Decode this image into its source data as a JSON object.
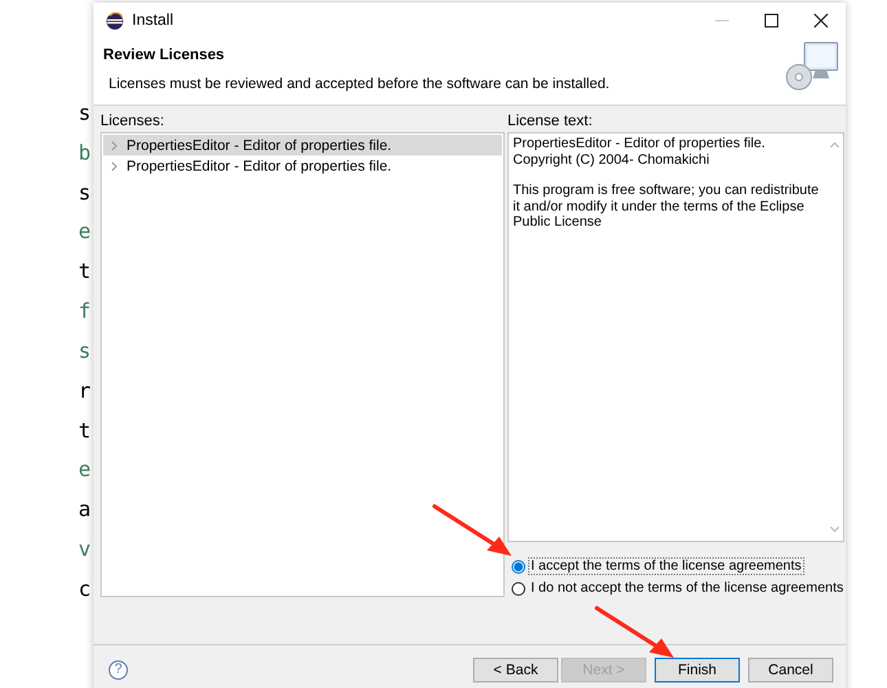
{
  "background_window": {
    "left_letters": [
      {
        "text": "s",
        "color": "#000000"
      },
      {
        "text": "b",
        "color": "#3f7f5f"
      },
      {
        "text": "s",
        "color": "#000000"
      },
      {
        "text": "e",
        "color": "#3f7f5f"
      },
      {
        "text": "t",
        "color": "#000000"
      },
      {
        "text": "f",
        "color": "#3f7f5f"
      },
      {
        "text": "s",
        "color": "#3f7f5f"
      },
      {
        "text": "r",
        "color": "#000000"
      },
      {
        "text": "t",
        "color": "#000000"
      },
      {
        "text": "e",
        "color": "#3f7f5f"
      },
      {
        "text": "a",
        "color": "#000000"
      },
      {
        "text": "v",
        "color": "#3f7f5f"
      },
      {
        "text": "c",
        "color": "#000000"
      }
    ]
  },
  "window": {
    "title": "Install",
    "minimize_disabled": true
  },
  "header": {
    "title": "Review Licenses",
    "description": "Licenses must be reviewed and accepted before the software can be installed."
  },
  "licenses": {
    "label": "Licenses:",
    "items": [
      {
        "label": "PropertiesEditor - Editor of properties file.",
        "selected": true
      },
      {
        "label": "PropertiesEditor - Editor of properties file.",
        "selected": false
      }
    ]
  },
  "license_text": {
    "label": "License text:",
    "paragraphs": [
      [
        "PropertiesEditor - Editor of properties file.",
        "Copyright (C) 2004-  Chomakichi"
      ],
      [
        "This program is free software; you can redistribute",
        "it and/or modify it under the terms of the Eclipse",
        "Public License"
      ]
    ]
  },
  "choices": [
    {
      "label": "I accept the terms of the license agreements",
      "selected": true
    },
    {
      "label": "I do not accept the terms of the license agreements",
      "selected": false
    }
  ],
  "help_button": {
    "label": "?"
  },
  "buttons": [
    {
      "label": "< Back",
      "disabled": false,
      "default": false
    },
    {
      "label": "Next >",
      "disabled": true,
      "default": false
    },
    {
      "label": "Finish",
      "disabled": false,
      "default": true
    },
    {
      "label": "Cancel",
      "disabled": false,
      "default": false
    }
  ],
  "annotations": [
    {
      "kind": "arrow"
    },
    {
      "kind": "arrow"
    }
  ]
}
